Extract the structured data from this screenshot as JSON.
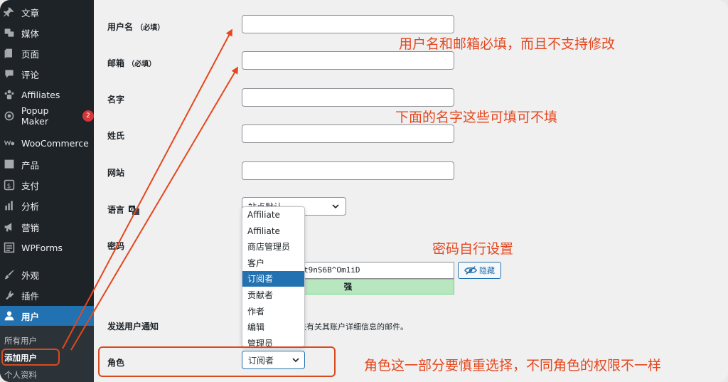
{
  "sidebar": {
    "items": [
      {
        "label": "文章",
        "icon": "pin-icon"
      },
      {
        "label": "媒体",
        "icon": "media-icon"
      },
      {
        "label": "页面",
        "icon": "page-icon"
      },
      {
        "label": "评论",
        "icon": "comment-icon"
      },
      {
        "label": "Affiliates",
        "icon": "affiliates-icon"
      },
      {
        "label": "Popup Maker",
        "icon": "popup-icon",
        "badge": "2"
      },
      {
        "label": "WooCommerce",
        "icon": "woocommerce-icon"
      },
      {
        "label": "产品",
        "icon": "product-icon"
      },
      {
        "label": "支付",
        "icon": "payment-icon"
      },
      {
        "label": "分析",
        "icon": "analytics-icon"
      },
      {
        "label": "营销",
        "icon": "megaphone-icon"
      },
      {
        "label": "WPForms",
        "icon": "wpforms-icon"
      },
      {
        "label": "外观",
        "icon": "brush-icon"
      },
      {
        "label": "插件",
        "icon": "plugin-icon"
      },
      {
        "label": "用户",
        "icon": "user-icon",
        "active": true
      }
    ],
    "submenu": [
      {
        "label": "所有用户"
      },
      {
        "label": "添加用户",
        "current": true
      },
      {
        "label": "个人资料"
      }
    ]
  },
  "form": {
    "username_label": "用户名",
    "username_req": "（必填）",
    "username_value": "",
    "email_label": "邮箱",
    "email_req": "（必填）",
    "email_value": "",
    "firstname_label": "名字",
    "firstname_value": "",
    "lastname_label": "姓氏",
    "lastname_value": "",
    "website_label": "网站",
    "website_value": "",
    "language_label": "语言",
    "language_value": "站点默认",
    "password_label": "密码",
    "password_value": "t9nS6B^Om1iD",
    "password_strength": "强",
    "hide_button": "隐藏",
    "notify_label": "发送用户通知",
    "notify_text": "关有关其账户详细信息的邮件。",
    "role_label": "角色",
    "role_value": "订阅者"
  },
  "role_options": [
    "Affiliate",
    "Affiliate",
    "商店管理员",
    "客户",
    "订阅者",
    "贡献者",
    "作者",
    "编辑",
    "管理员"
  ],
  "role_selected_index": 4,
  "annotations": {
    "a1": "用户名和邮箱必填，而且不支持修改",
    "a2": "下面的名字这些可填可不填",
    "a3": "密码自行设置",
    "a4": "角色这一部分要慎重选择，不同角色的权限不一样"
  },
  "colors": {
    "sidebar_bg": "#1d2327",
    "accent": "#2271b1",
    "annotation": "#e4471d",
    "strength_bg": "#b8e6bf",
    "badge": "#d63638"
  }
}
